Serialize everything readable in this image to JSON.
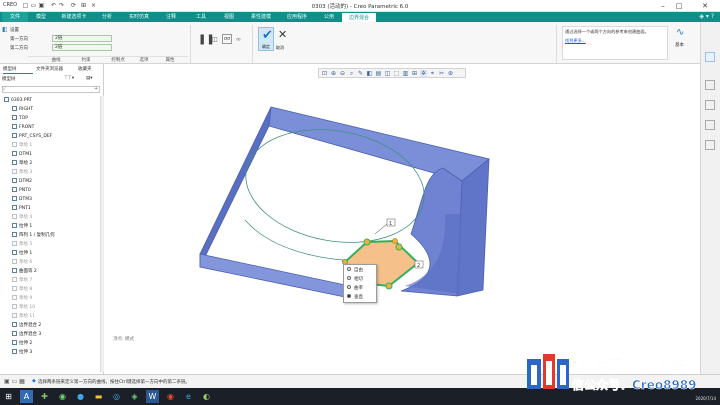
{
  "titlebar": {
    "logo": "CREO",
    "title": "0303 (活动的) - Creo Parametric 6.0"
  },
  "menubar": {
    "items": [
      "文件",
      "模型",
      "新建选项卡",
      "分析",
      "实时仿真",
      "注释",
      "工具",
      "视图",
      "柔性建模",
      "应用程序",
      "公用",
      "边界混合"
    ]
  },
  "ribbon": {
    "settings_label": "设置",
    "first_dir_label": "第一方向",
    "first_dir_value": "2链",
    "second_dir_label": "第二方向",
    "second_dir_value": "2链",
    "groups": [
      "曲线",
      "约束",
      "控制点",
      "选项",
      "属性"
    ],
    "ok_label": "确定",
    "cancel_label": "取消",
    "hint_text": "通过选择一个或两个方向的参考来创建曲面。",
    "hint_link": "找到更多...",
    "right_label": "基本"
  },
  "leftpanel": {
    "tabs": [
      "模型树",
      "文件夹浏览器",
      "收藏夹"
    ],
    "tree_label": "模型树",
    "items": [
      {
        "label": "0303.PRT",
        "dim": false
      },
      {
        "label": "RIGHT",
        "dim": false
      },
      {
        "label": "TOP",
        "dim": false
      },
      {
        "label": "FRONT",
        "dim": false
      },
      {
        "label": "PRT_CSYS_DEF",
        "dim": false
      },
      {
        "label": "草绘 1",
        "dim": true
      },
      {
        "label": "DTM1",
        "dim": false
      },
      {
        "label": "草绘 2",
        "dim": false
      },
      {
        "label": "草绘 3",
        "dim": true
      },
      {
        "label": "DTM2",
        "dim": false
      },
      {
        "label": "PNT0",
        "dim": false
      },
      {
        "label": "DTM3",
        "dim": false
      },
      {
        "label": "PNT1",
        "dim": false
      },
      {
        "label": "草绘 4",
        "dim": true
      },
      {
        "label": "拉伸 1",
        "dim": false
      },
      {
        "label": "阵列 1 / 复制几何",
        "dim": false
      },
      {
        "label": "草绘 5",
        "dim": true
      },
      {
        "label": "拉伸 1",
        "dim": false
      },
      {
        "label": "草绘 6",
        "dim": true
      },
      {
        "label": "曲面等 2",
        "dim": false
      },
      {
        "label": "草绘 7",
        "dim": true
      },
      {
        "label": "草绘 8",
        "dim": true
      },
      {
        "label": "草绘 9",
        "dim": true
      },
      {
        "label": "草绘 10",
        "dim": true
      },
      {
        "label": "草绘 11",
        "dim": true
      },
      {
        "label": "边界混合 2",
        "dim": false
      },
      {
        "label": "边界混合 3",
        "dim": false
      },
      {
        "label": "拉伸 2",
        "dim": false
      },
      {
        "label": "拉伸 3",
        "dim": false
      }
    ]
  },
  "context_menu": {
    "items": [
      "自由",
      "相切",
      "曲率",
      "垂直"
    ],
    "selected_index": 3
  },
  "viewport": {
    "note": "顶点: 模式",
    "callout_1": "1",
    "callout_2": "2"
  },
  "statusbar": {
    "message": "选择两条链来定义第一方向的曲线，按住Ctrl键选择第一方向中的第二条链。"
  },
  "taskbar": {
    "date": "2020/7/14"
  },
  "watermark": {
    "line1": "想要学习更多请关注微",
    "line2": "信公众号：Creo8989"
  },
  "colors": {
    "menubar": "#0f8f8a",
    "frame_face": "#6b7fcf",
    "patch_fill": "#f5c089",
    "highlight": "#2fb35a",
    "accent_blue": "#1b75c9"
  }
}
